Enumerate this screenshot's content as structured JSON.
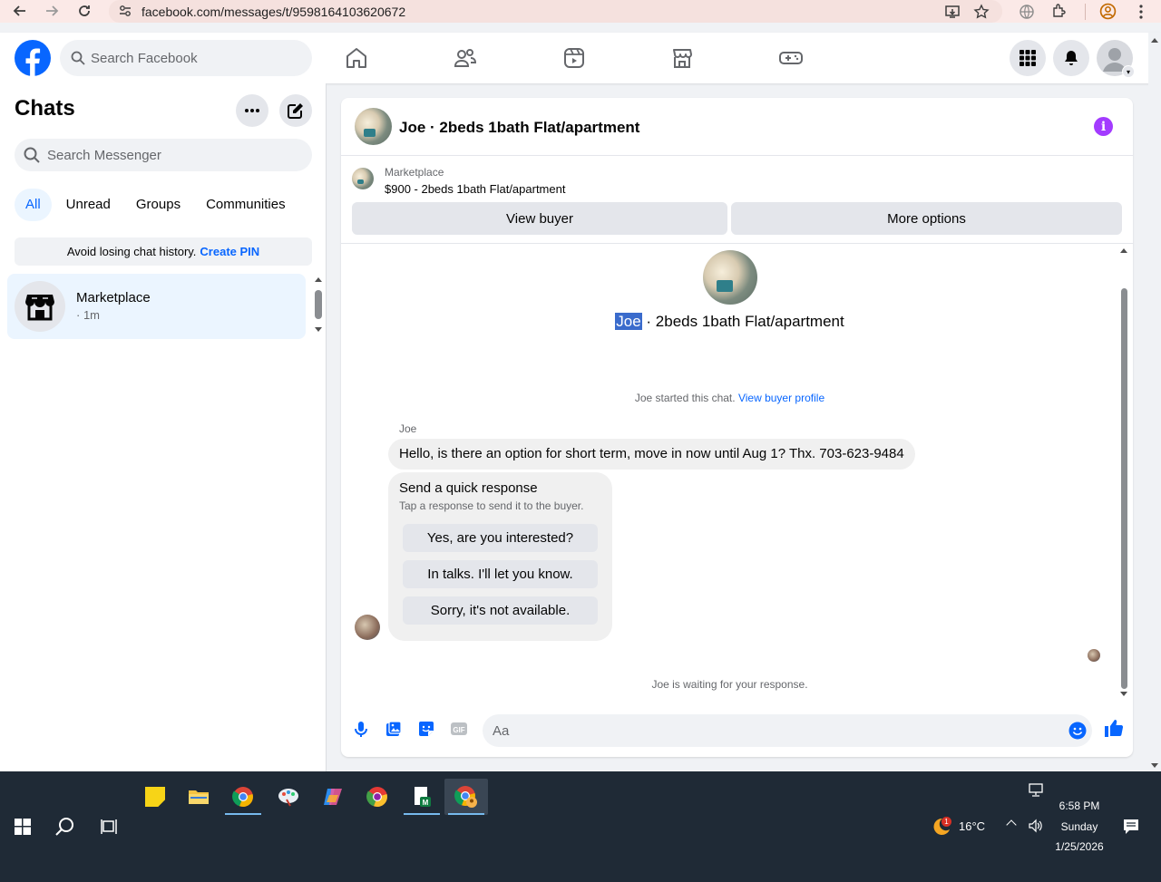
{
  "browser": {
    "url": "facebook.com/messages/t/9598164103620672"
  },
  "header": {
    "search_placeholder": "Search Facebook"
  },
  "sidebar": {
    "title": "Chats",
    "search_placeholder": "Search Messenger",
    "filters": [
      "All",
      "Unread",
      "Groups",
      "Communities"
    ],
    "active_filter": "All",
    "pin_banner_text": "Avoid losing chat history.",
    "pin_banner_link": "Create PIN",
    "chats": [
      {
        "name": "Marketplace",
        "time": "· 1m"
      }
    ]
  },
  "conversation": {
    "title": "Joe · 2beds 1bath Flat/apartment",
    "marketplace_label": "Marketplace",
    "listing_price_title": "$900 - 2beds 1bath Flat/apartment",
    "view_buyer_label": "View buyer",
    "more_options_label": "More options",
    "center_title_highlight": "Joe",
    "center_title_rest": " · 2beds 1bath Flat/apartment",
    "started_note": "Joe started this chat.",
    "view_buyer_profile_link": "View buyer profile",
    "sender_name": "Joe",
    "message_text": "Hello, is there an option for short term, move in now until Aug 1? Thx. 703-623-9484",
    "quick_response": {
      "title": "Send a quick response",
      "subtitle": "Tap a response to send it to the buyer.",
      "options": [
        "Yes, are you interested?",
        "In talks. I'll let you know.",
        "Sorry, it's not available."
      ]
    },
    "waiting_note": "Joe is waiting for your response.",
    "composer_placeholder": "Aa"
  },
  "taskbar": {
    "weather_badge": "1",
    "temperature": "16°C",
    "time": "6:58 PM",
    "day": "Sunday",
    "date": "1/25/2026"
  },
  "colors": {
    "facebook_blue": "#0866ff",
    "info_purple": "#a33bff",
    "taskbar": "#1f2a36"
  }
}
